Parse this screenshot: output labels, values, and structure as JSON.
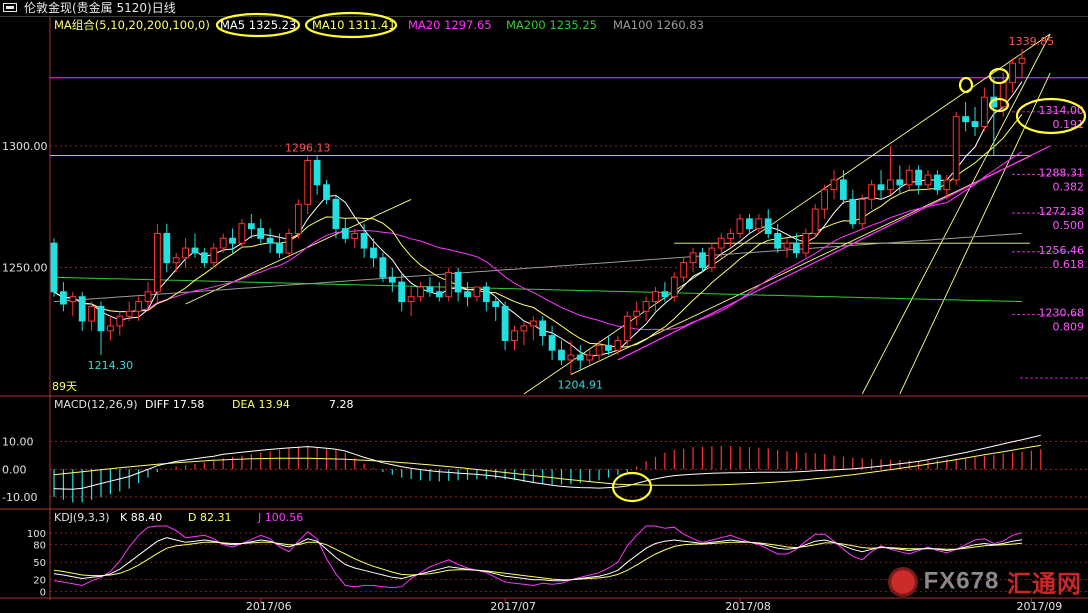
{
  "window": {
    "title": "伦敦金现(贵金属 5120)日线",
    "icon": "window-menu-icon"
  },
  "ma_legend": {
    "label": "MA组合(5,10,20,200,100,0)",
    "items": [
      {
        "text": "MA5 1325.23",
        "color": "#ffffff",
        "circled": true
      },
      {
        "text": "MA10 1311.41",
        "color": "#ffff66",
        "circled": true
      },
      {
        "text": "MA20 1297.65",
        "color": "#ff33ff",
        "circled": false
      },
      {
        "text": "MA200 1235.25",
        "color": "#33cc33",
        "circled": false
      },
      {
        "text": "MA100 1260.83",
        "color": "#9a9a9a",
        "circled": false
      }
    ]
  },
  "price_axis": {
    "ticks": [
      {
        "value": 1300,
        "label": "1300.00"
      },
      {
        "value": 1250,
        "label": "1250.00"
      }
    ],
    "range": [
      1198,
      1346
    ]
  },
  "price_annotations": {
    "high_label": "1339.85",
    "peak_label": "1296.13",
    "low1_label": "1214.30",
    "low2_label": "1204.91",
    "days_label": "89天",
    "ref_price": 1328.0
  },
  "fibonacci": [
    {
      "value": 1314.0,
      "price_label": "1314.00",
      "ratio_label": "0.191"
    },
    {
      "value": 1288.31,
      "price_label": "1288.31",
      "ratio_label": "0.382"
    },
    {
      "value": 1272.38,
      "price_label": "1272.38",
      "ratio_label": "0.500"
    },
    {
      "value": 1256.46,
      "price_label": "1256.46",
      "ratio_label": "0.618"
    },
    {
      "value": 1230.68,
      "price_label": "1230.68",
      "ratio_label": "0.809"
    }
  ],
  "macd": {
    "label": "MACD(12,26,9)",
    "diff_text": "DIFF  17.58",
    "dea_text": "DEA  13.94",
    "macd_text": "7.28",
    "ticks": [
      {
        "value": 10,
        "label": "10.00"
      },
      {
        "value": 0,
        "label": "0.00"
      },
      {
        "value": -10,
        "label": "-10.00"
      }
    ],
    "range": [
      -14,
      20
    ]
  },
  "kdj": {
    "label": "KDJ(9,3,3)",
    "k_text": "K  88.40",
    "d_text": "D  82.31",
    "j_text": "J  100.56",
    "ticks": [
      {
        "value": 100,
        "label": "100"
      },
      {
        "value": 80,
        "label": "80"
      },
      {
        "value": 50,
        "label": "50"
      },
      {
        "value": 20,
        "label": "20"
      },
      {
        "value": 0,
        "label": "0"
      }
    ],
    "range": [
      -8,
      112
    ]
  },
  "date_axis": {
    "labels": [
      "2017/06",
      "2017/07",
      "2017/08",
      "2017/09"
    ]
  },
  "colors": {
    "up": "#ff3333",
    "down": "#22e0e0",
    "ma5": "#ffffff",
    "ma10": "#ffff66",
    "ma20": "#ff33ff",
    "ma100": "#9a9a9a",
    "ma200": "#33cc33",
    "trend": "#ffff88",
    "annotation": "#ffff33",
    "grid": "#b03030"
  },
  "watermark": {
    "text_a": "FX678",
    "text_b": "汇通网"
  },
  "chart_data": {
    "type": "candlestick",
    "title": "伦敦金现(贵金属 5120)日线",
    "ohlc": [
      [
        1260,
        1262,
        1238,
        1240
      ],
      [
        1240,
        1244,
        1232,
        1235
      ],
      [
        1236,
        1240,
        1230,
        1238
      ],
      [
        1238,
        1240,
        1224,
        1228
      ],
      [
        1228,
        1236,
        1224,
        1234
      ],
      [
        1234,
        1236,
        1214,
        1224
      ],
      [
        1224,
        1230,
        1220,
        1226
      ],
      [
        1226,
        1232,
        1222,
        1230
      ],
      [
        1230,
        1236,
        1228,
        1232
      ],
      [
        1232,
        1238,
        1228,
        1236
      ],
      [
        1236,
        1244,
        1232,
        1240
      ],
      [
        1240,
        1268,
        1236,
        1264
      ],
      [
        1264,
        1268,
        1248,
        1252
      ],
      [
        1252,
        1256,
        1248,
        1254
      ],
      [
        1254,
        1262,
        1250,
        1258
      ],
      [
        1258,
        1264,
        1254,
        1256
      ],
      [
        1256,
        1258,
        1250,
        1252
      ],
      [
        1252,
        1260,
        1250,
        1258
      ],
      [
        1258,
        1264,
        1256,
        1262
      ],
      [
        1262,
        1266,
        1256,
        1260
      ],
      [
        1260,
        1270,
        1258,
        1268
      ],
      [
        1268,
        1272,
        1262,
        1266
      ],
      [
        1266,
        1270,
        1260,
        1262
      ],
      [
        1262,
        1266,
        1256,
        1260
      ],
      [
        1260,
        1264,
        1254,
        1256
      ],
      [
        1256,
        1266,
        1254,
        1264
      ],
      [
        1264,
        1278,
        1262,
        1276
      ],
      [
        1276,
        1296,
        1272,
        1294
      ],
      [
        1294,
        1296,
        1280,
        1284
      ],
      [
        1284,
        1286,
        1276,
        1278
      ],
      [
        1278,
        1280,
        1262,
        1266
      ],
      [
        1266,
        1270,
        1260,
        1262
      ],
      [
        1262,
        1266,
        1258,
        1264
      ],
      [
        1264,
        1268,
        1254,
        1258
      ],
      [
        1258,
        1262,
        1250,
        1254
      ],
      [
        1254,
        1256,
        1244,
        1246
      ],
      [
        1246,
        1250,
        1240,
        1244
      ],
      [
        1244,
        1248,
        1232,
        1236
      ],
      [
        1236,
        1242,
        1230,
        1238
      ],
      [
        1238,
        1244,
        1236,
        1242
      ],
      [
        1242,
        1246,
        1238,
        1240
      ],
      [
        1240,
        1244,
        1236,
        1238
      ],
      [
        1238,
        1250,
        1236,
        1248
      ],
      [
        1248,
        1250,
        1236,
        1240
      ],
      [
        1240,
        1244,
        1234,
        1238
      ],
      [
        1238,
        1242,
        1236,
        1242
      ],
      [
        1242,
        1244,
        1232,
        1236
      ],
      [
        1236,
        1238,
        1228,
        1234
      ],
      [
        1234,
        1236,
        1216,
        1220
      ],
      [
        1220,
        1226,
        1216,
        1224
      ],
      [
        1224,
        1228,
        1218,
        1226
      ],
      [
        1226,
        1230,
        1220,
        1228
      ],
      [
        1228,
        1230,
        1218,
        1222
      ],
      [
        1222,
        1226,
        1212,
        1216
      ],
      [
        1216,
        1220,
        1210,
        1212
      ],
      [
        1212,
        1220,
        1206,
        1214
      ],
      [
        1214,
        1218,
        1208,
        1212
      ],
      [
        1212,
        1216,
        1210,
        1214
      ],
      [
        1214,
        1220,
        1212,
        1218
      ],
      [
        1218,
        1222,
        1214,
        1216
      ],
      [
        1216,
        1222,
        1214,
        1220
      ],
      [
        1220,
        1232,
        1218,
        1230
      ],
      [
        1230,
        1236,
        1226,
        1232
      ],
      [
        1232,
        1238,
        1228,
        1236
      ],
      [
        1236,
        1242,
        1232,
        1240
      ],
      [
        1240,
        1244,
        1236,
        1238
      ],
      [
        1238,
        1248,
        1236,
        1246
      ],
      [
        1246,
        1254,
        1244,
        1252
      ],
      [
        1252,
        1258,
        1248,
        1256
      ],
      [
        1256,
        1258,
        1248,
        1250
      ],
      [
        1250,
        1260,
        1248,
        1258
      ],
      [
        1258,
        1264,
        1254,
        1262
      ],
      [
        1262,
        1266,
        1258,
        1264
      ],
      [
        1264,
        1272,
        1262,
        1270
      ],
      [
        1270,
        1272,
        1264,
        1266
      ],
      [
        1266,
        1272,
        1264,
        1270
      ],
      [
        1270,
        1274,
        1262,
        1264
      ],
      [
        1264,
        1268,
        1256,
        1258
      ],
      [
        1258,
        1262,
        1254,
        1260
      ],
      [
        1260,
        1264,
        1254,
        1256
      ],
      [
        1256,
        1266,
        1254,
        1264
      ],
      [
        1264,
        1276,
        1262,
        1274
      ],
      [
        1274,
        1284,
        1270,
        1282
      ],
      [
        1282,
        1290,
        1278,
        1286
      ],
      [
        1286,
        1290,
        1276,
        1278
      ],
      [
        1278,
        1282,
        1266,
        1268
      ],
      [
        1268,
        1280,
        1266,
        1278
      ],
      [
        1278,
        1286,
        1274,
        1284
      ],
      [
        1284,
        1290,
        1278,
        1282
      ],
      [
        1282,
        1300,
        1280,
        1286
      ],
      [
        1286,
        1292,
        1280,
        1284
      ],
      [
        1284,
        1292,
        1282,
        1290
      ],
      [
        1290,
        1292,
        1280,
        1284
      ],
      [
        1284,
        1290,
        1282,
        1288
      ],
      [
        1288,
        1290,
        1280,
        1282
      ],
      [
        1282,
        1288,
        1278,
        1286
      ],
      [
        1286,
        1314,
        1284,
        1312
      ],
      [
        1312,
        1318,
        1306,
        1310
      ],
      [
        1310,
        1316,
        1304,
        1308
      ],
      [
        1308,
        1324,
        1306,
        1320
      ],
      [
        1320,
        1328,
        1296,
        1316
      ],
      [
        1316,
        1330,
        1312,
        1326
      ],
      [
        1326,
        1336,
        1322,
        1334
      ],
      [
        1334,
        1340,
        1328,
        1336
      ]
    ],
    "macd_hist": [
      -10,
      -11,
      -12,
      -12,
      -11,
      -10,
      -9,
      -8,
      -7,
      -5,
      -3,
      -1,
      0,
      1,
      1.5,
      2,
      2.5,
      3,
      4,
      4.5,
      5,
      5.5,
      6,
      6.5,
      7,
      7.5,
      8,
      8.5,
      8,
      7.5,
      7,
      6,
      4,
      2,
      0.5,
      -1,
      -2,
      -3,
      -3.5,
      -4,
      -4.2,
      -4.4,
      -4.2,
      -4,
      -3.8,
      -3.6,
      -3.5,
      -3.4,
      -3.6,
      -4,
      -4.5,
      -5,
      -5.2,
      -5.5,
      -5.6,
      -5.4,
      -5,
      -4.5,
      -4,
      -3,
      -2,
      -1,
      1,
      3,
      4.5,
      6,
      7,
      7.5,
      8,
      8.2,
      8.4,
      8.5,
      8.4,
      8.2,
      8,
      7.8,
      7.5,
      7,
      6.5,
      6.2,
      6,
      5.8,
      5.5,
      5,
      4.6,
      4.2,
      4,
      3.8,
      3.6,
      3.5,
      3.4,
      3.2,
      3,
      3.2,
      3.4,
      3.6,
      3.8,
      4,
      4.4,
      4.8,
      5.2,
      5.6,
      6,
      6.4,
      6.8,
      7.28
    ],
    "kdj_k": [
      30,
      28,
      25,
      22,
      24,
      26,
      30,
      38,
      50,
      62,
      74,
      86,
      92,
      88,
      84,
      86,
      88,
      86,
      82,
      80,
      82,
      85,
      88,
      86,
      80,
      76,
      82,
      90,
      86,
      72,
      58,
      46,
      40,
      36,
      32,
      28,
      24,
      22,
      26,
      30,
      34,
      38,
      42,
      40,
      38,
      36,
      34,
      30,
      26,
      24,
      22,
      20,
      20,
      18,
      18,
      20,
      22,
      24,
      26,
      30,
      36,
      50,
      62,
      74,
      82,
      86,
      88,
      86,
      84,
      82,
      84,
      86,
      88,
      86,
      84,
      82,
      78,
      74,
      72,
      74,
      80,
      86,
      88,
      84,
      78,
      72,
      68,
      72,
      76,
      74,
      72,
      70,
      72,
      74,
      72,
      70,
      72,
      76,
      80,
      82,
      80,
      82,
      86,
      88.4
    ],
    "kdj_d": [
      36,
      34,
      31,
      28,
      27,
      27,
      28,
      31,
      37,
      45,
      55,
      65,
      74,
      78,
      80,
      82,
      84,
      84,
      83,
      82,
      82,
      83,
      84,
      84,
      82,
      80,
      80,
      84,
      84,
      80,
      72,
      64,
      56,
      49,
      43,
      38,
      33,
      29,
      28,
      29,
      30,
      33,
      36,
      37,
      37,
      36,
      35,
      33,
      31,
      29,
      27,
      25,
      23,
      21,
      20,
      20,
      21,
      22,
      23,
      25,
      29,
      36,
      45,
      55,
      64,
      71,
      77,
      80,
      81,
      81,
      82,
      83,
      84,
      84,
      84,
      83,
      81,
      79,
      76,
      75,
      77,
      80,
      83,
      83,
      81,
      78,
      75,
      74,
      75,
      75,
      74,
      73,
      73,
      73,
      73,
      72,
      72,
      74,
      76,
      78,
      79,
      80,
      81,
      82.31
    ],
    "kdj_j": [
      18,
      16,
      13,
      10,
      18,
      24,
      34,
      52,
      76,
      96,
      110,
      112,
      112,
      104,
      92,
      94,
      96,
      90,
      80,
      76,
      82,
      89,
      96,
      90,
      76,
      68,
      86,
      102,
      90,
      56,
      30,
      10,
      8,
      10,
      10,
      8,
      6,
      8,
      22,
      32,
      42,
      48,
      54,
      46,
      40,
      36,
      32,
      24,
      16,
      14,
      12,
      10,
      14,
      12,
      14,
      20,
      24,
      28,
      32,
      40,
      50,
      78,
      96,
      112,
      112,
      108,
      110,
      98,
      90,
      84,
      88,
      92,
      96,
      90,
      84,
      80,
      72,
      64,
      64,
      72,
      86,
      98,
      98,
      86,
      72,
      60,
      54,
      68,
      78,
      72,
      68,
      64,
      70,
      76,
      70,
      66,
      72,
      80,
      88,
      90,
      82,
      86,
      96,
      100.56
    ]
  }
}
